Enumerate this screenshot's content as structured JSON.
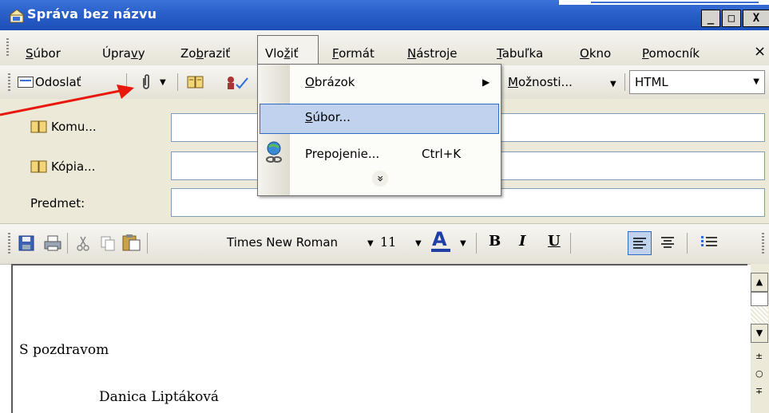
{
  "window": {
    "title": "Správa bez názvu",
    "buttons": [
      "_",
      "□",
      "X"
    ]
  },
  "menubar": {
    "items": [
      {
        "label": "Súbor",
        "key": "S"
      },
      {
        "label": "Úpravy",
        "key": "v"
      },
      {
        "label": "Zobraziť",
        "key": "b"
      },
      {
        "label": "Vložiť",
        "key": "ž"
      },
      {
        "label": "Formát",
        "key": "F"
      },
      {
        "label": "Nástroje",
        "key": "N"
      },
      {
        "label": "Tabuľka",
        "key": "T"
      },
      {
        "label": "Okno",
        "key": "O"
      },
      {
        "label": "Pomocník",
        "key": "P"
      }
    ],
    "close": "×"
  },
  "toolbar1": {
    "send_label": "Odoslať",
    "options_label": "Možnosti...",
    "format_value": "HTML"
  },
  "fields": {
    "to_label": "Komu...",
    "cc_label": "Kópia...",
    "subject_label": "Predmet:"
  },
  "toolbar2": {
    "font_value": "Times New Roman",
    "size_value": "11",
    "bold": "B",
    "italic": "I",
    "underline": "U"
  },
  "insert_menu": {
    "items": [
      {
        "label": "Obrázok",
        "shortcut": ""
      },
      {
        "label": "Súbor...",
        "shortcut": ""
      },
      {
        "label": "Prepojenie...",
        "shortcut": "Ctrl+K"
      }
    ],
    "expand": "»"
  },
  "message": {
    "greeting": "S pozdravom",
    "signature": "Danica Liptáková"
  },
  "icons": {
    "attach": "paperclip-icon",
    "address_book": "address-book-icon",
    "save": "save-icon",
    "print": "print-icon",
    "cut": "cut-icon",
    "copy": "copy-icon",
    "paste": "paste-icon",
    "hyperlink": "hyperlink-icon"
  },
  "colors": {
    "title_bar": "#2a5fc9",
    "menu_highlight": "#c1d2ee",
    "annotation_arrow": "#e8180c"
  }
}
